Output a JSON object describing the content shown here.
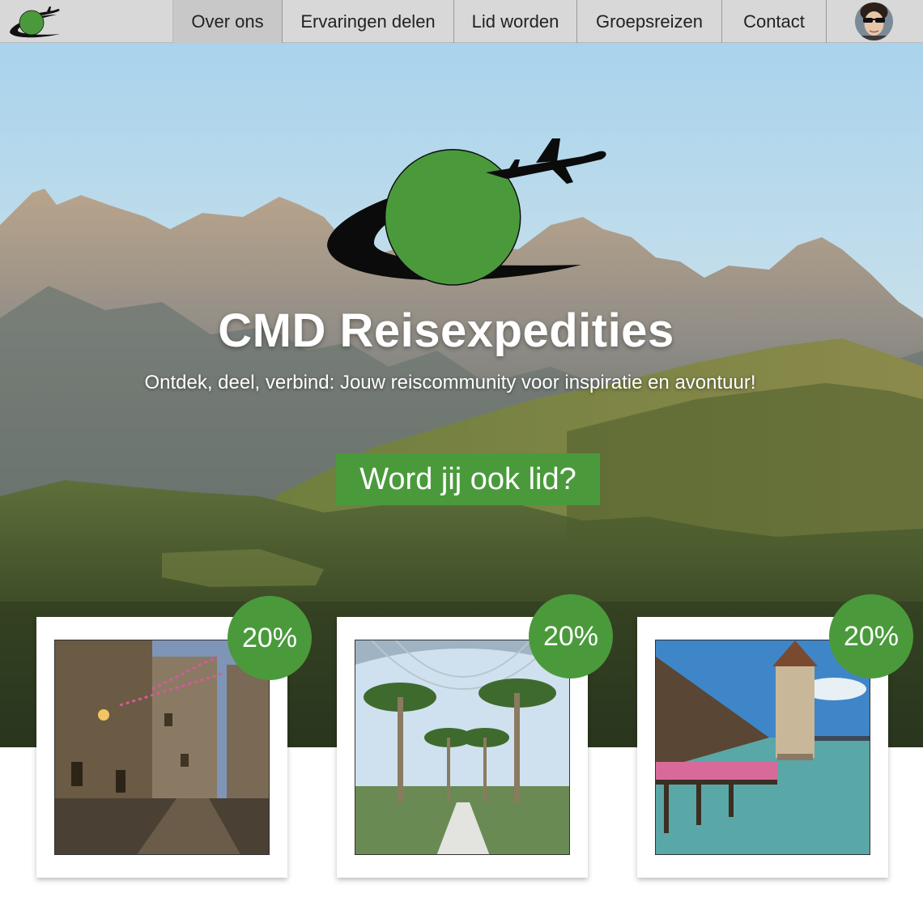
{
  "nav": {
    "items": [
      {
        "label": "Over ons",
        "active": true
      },
      {
        "label": "Ervaringen delen",
        "active": false
      },
      {
        "label": "Lid worden",
        "active": false
      },
      {
        "label": "Groepsreizen",
        "active": false
      },
      {
        "label": "Contact",
        "active": false
      }
    ],
    "logo_icon": "globe-plane-logo-icon",
    "avatar_icon": "user-avatar"
  },
  "hero": {
    "title": "CMD Reisexpedities",
    "tagline": "Ontdek, deel, verbind: Jouw reiscommunity voor inspiratie en avontuur!",
    "cta_label": "Word jij ook lid?",
    "background": "mountain-landscape-photo"
  },
  "cards": [
    {
      "discount": "20%",
      "photo": "village-street-evening-photo"
    },
    {
      "discount": "20%",
      "photo": "palm-tree-arcade-photo"
    },
    {
      "discount": "20%",
      "photo": "wooden-bridge-tower-lake-photo"
    }
  ],
  "colors": {
    "accent_green": "#4a9a3c",
    "nav_bg": "#d8d8d8"
  }
}
